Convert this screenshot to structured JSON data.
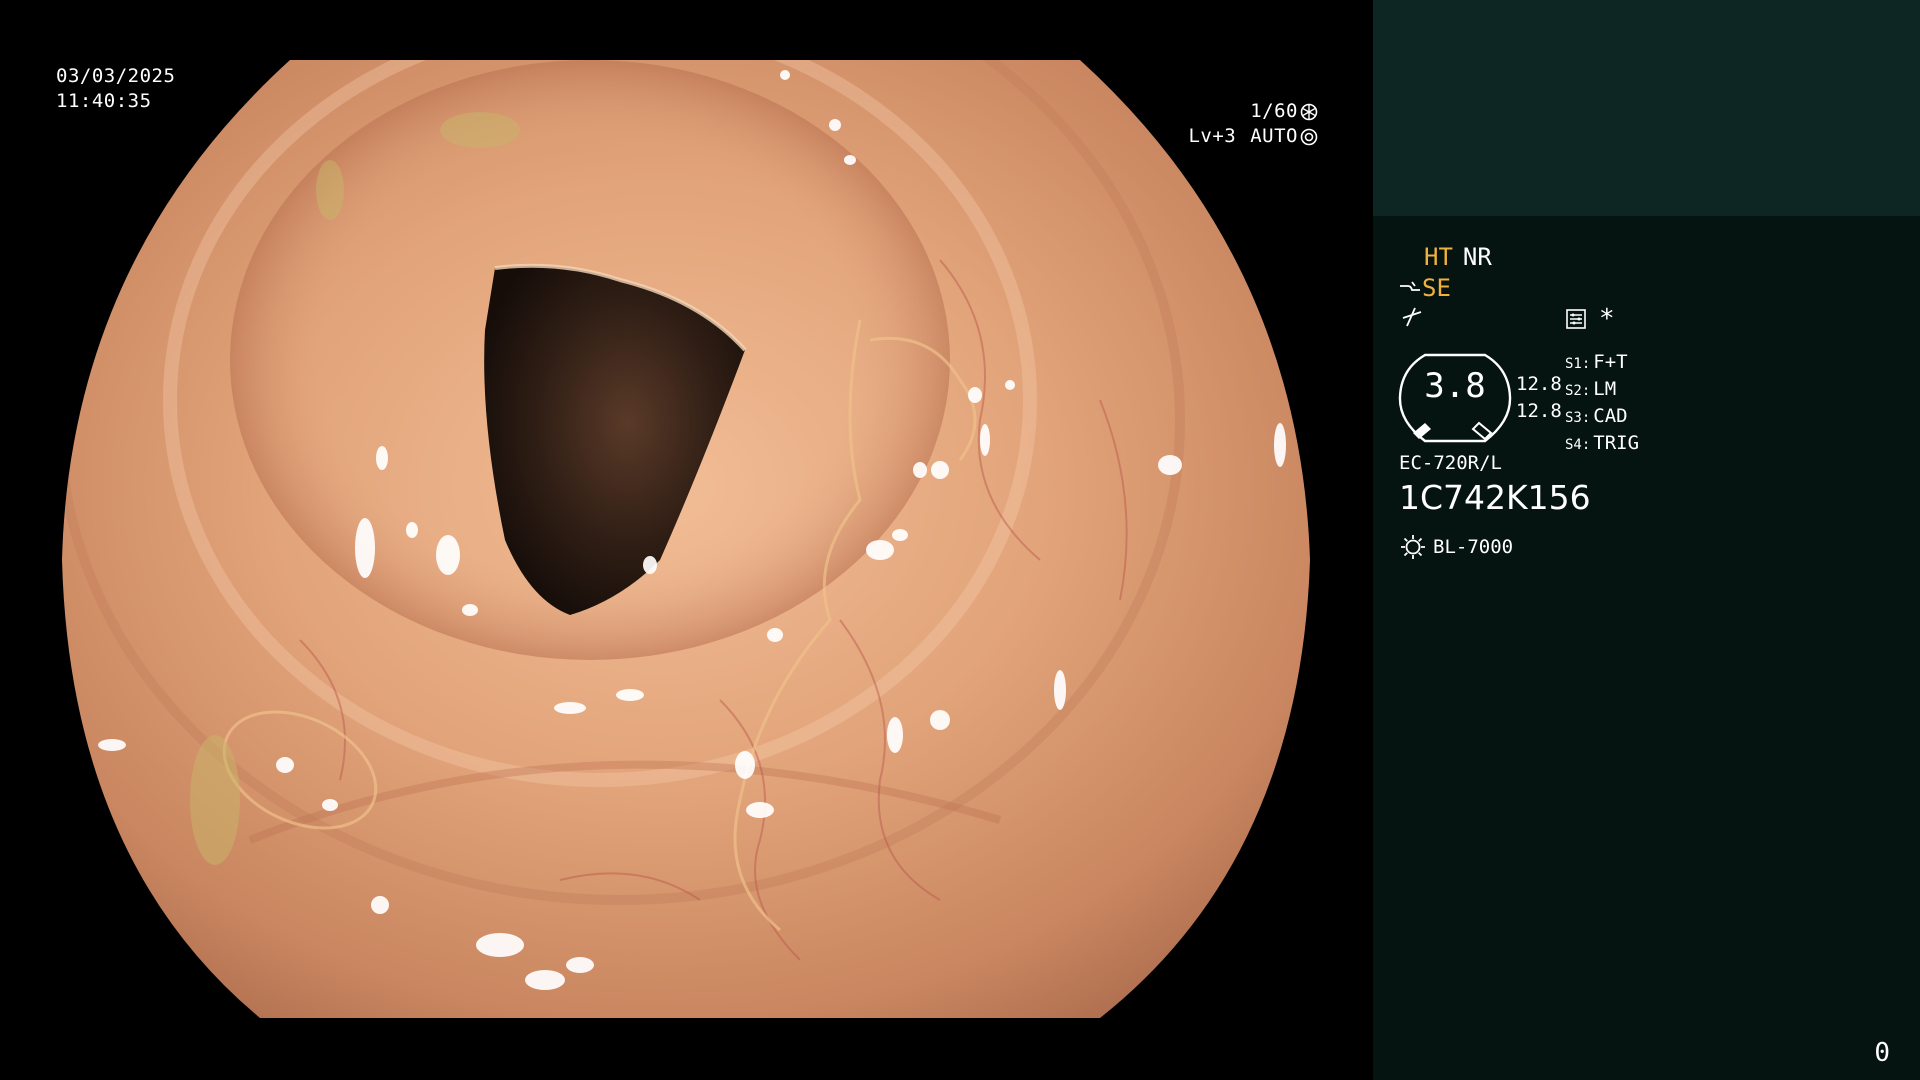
{
  "overlay": {
    "date": "03/03/2025",
    "time": "11:40:35",
    "shutter": "1/60",
    "shutter_icon": "shutter-icon",
    "level": "Lv+3",
    "iris_mode": "AUTO",
    "iris_icon": "iris-icon"
  },
  "panel": {
    "ht_label": "HT",
    "nr_label": "NR",
    "se_label": "SE",
    "se_icon": "gamma-curve-icon",
    "curve_icon": "tone-curve-icon",
    "menu_icon": "settings-card-icon",
    "asterisk": "*",
    "gauge_value": "3.8",
    "hz_top": "12.8",
    "hz_bottom": "12.8",
    "switches": [
      {
        "key": "S1:",
        "value": "F+T"
      },
      {
        "key": "S2:",
        "value": "LM"
      },
      {
        "key": "S3:",
        "value": "CAD"
      },
      {
        "key": "S4:",
        "value": "TRIG"
      }
    ],
    "scope_model": "EC-720R/L",
    "serial": "1C742K156",
    "light_source_icon": "light-source-icon",
    "light_source": "BL-7000",
    "counter": "0"
  },
  "colors": {
    "accent_orange": "#f0b23c",
    "panel_top": "#0d2523",
    "panel_bottom": "#051311",
    "tissue": "#d99a72"
  }
}
